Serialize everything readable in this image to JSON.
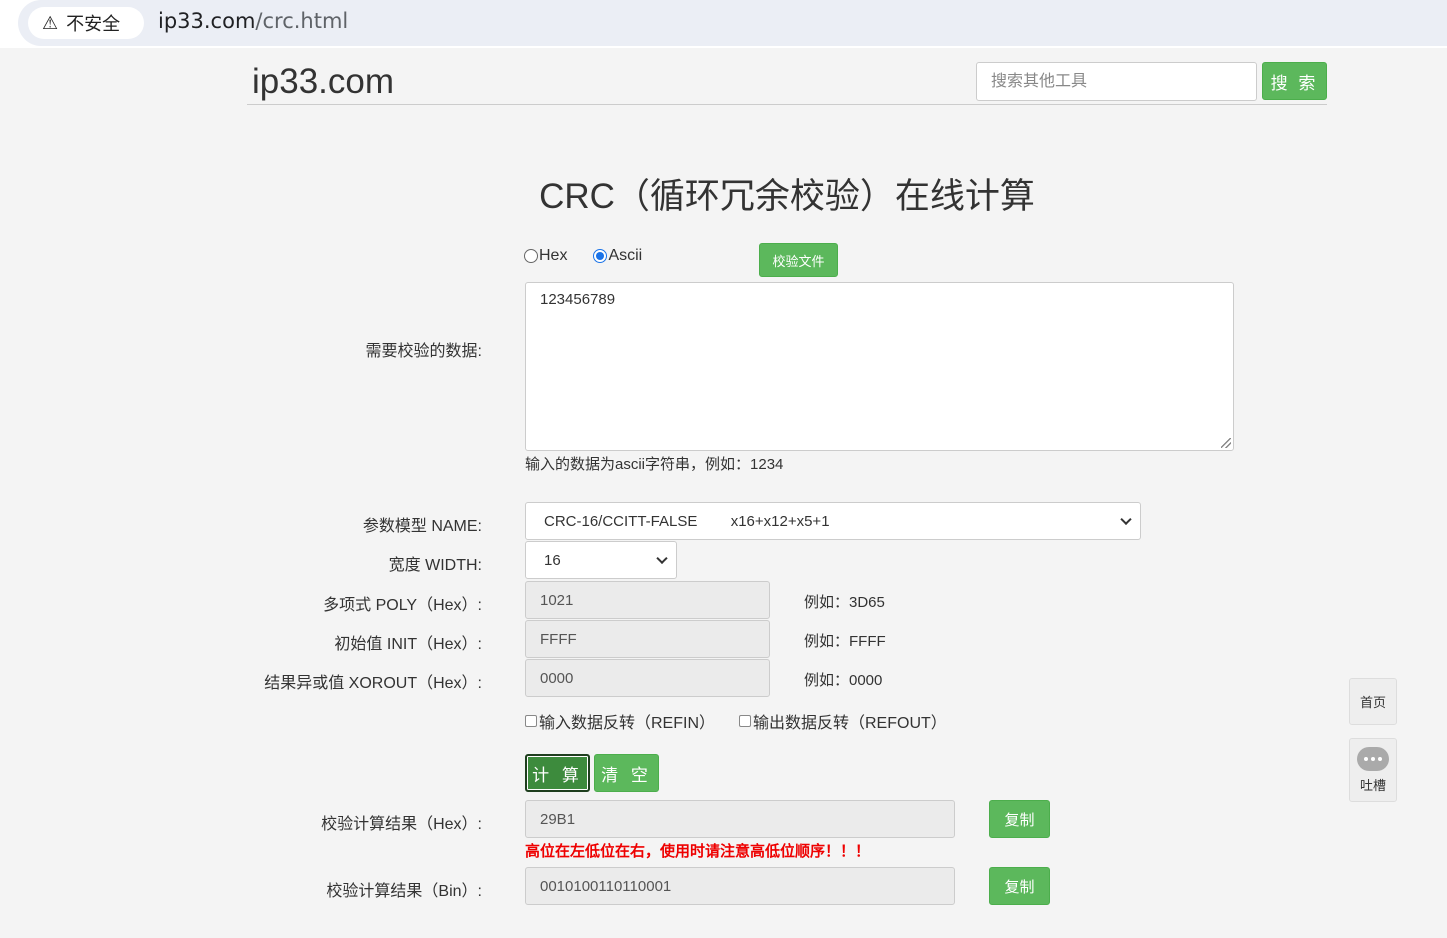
{
  "browser": {
    "security_label": "不安全",
    "url_host": "ip33.com",
    "url_path": "/crc.html"
  },
  "header": {
    "brand": "ip33.com",
    "search_placeholder": "搜索其他工具",
    "search_button": "搜 索"
  },
  "main": {
    "title": "CRC（循环冗余校验）在线计算",
    "format_options": [
      {
        "label": "Hex",
        "selected": false
      },
      {
        "label": "Ascii",
        "selected": true
      }
    ],
    "file_button": "校验文件",
    "data_label": "需要校验的数据:",
    "data_value": "123456789",
    "data_hint": "输入的数据为ascii字符串，例如：1234",
    "name_label": "参数模型 NAME:",
    "name_value": "CRC-16/CCITT-FALSE        x16+x12+x5+1",
    "width_label": "宽度 WIDTH:",
    "width_value": "16",
    "poly_label": "多项式 POLY（Hex）:",
    "poly_value": "1021",
    "poly_example": "例如：3D65",
    "init_label": "初始值 INIT（Hex）:",
    "init_value": "FFFF",
    "init_example": "例如：FFFF",
    "xorout_label": "结果异或值 XOROUT（Hex）:",
    "xorout_value": "0000",
    "xorout_example": "例如：0000",
    "refin_label": "输入数据反转（REFIN）",
    "refout_label": "输出数据反转（REFOUT）",
    "calc_button": "计 算",
    "clear_button": "清 空",
    "result_hex_label": "校验计算结果（Hex）:",
    "result_hex_value": "29B1",
    "copy_button": "复制",
    "warning": "高位在左低位在右，使用时请注意高低位顺序！！！",
    "result_bin_label": "校验计算结果（Bin）:",
    "result_bin_value": "0010100110110001"
  },
  "side": {
    "home": "首页",
    "feedback": "吐槽"
  }
}
